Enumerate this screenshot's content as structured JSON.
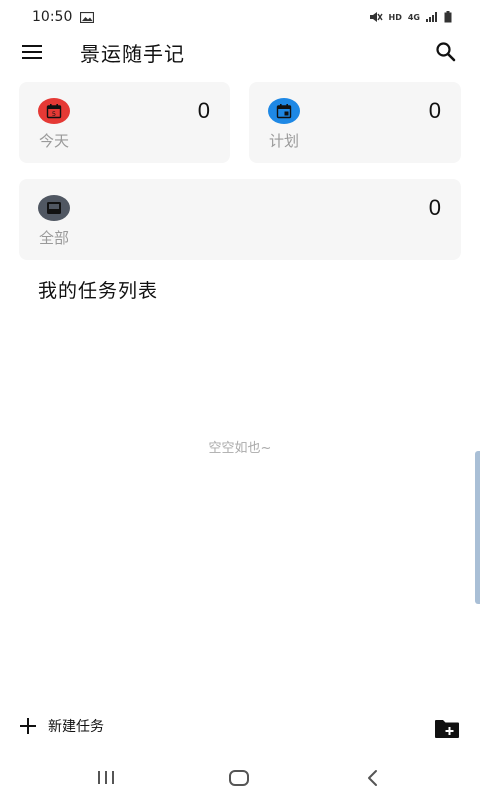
{
  "status_bar": {
    "time": "10:50",
    "network_label": "HD",
    "signal_label": "4G"
  },
  "app_bar": {
    "title": "景运随手记",
    "menu_icon": "menu-icon",
    "search_icon": "search-icon"
  },
  "cards": [
    {
      "id": "today",
      "label": "今天",
      "count": "0",
      "icon": "calendar-today-icon",
      "icon_bg": "#e53935",
      "icon_day": "5"
    },
    {
      "id": "planned",
      "label": "计划",
      "count": "0",
      "icon": "calendar-event-icon",
      "icon_bg": "#1e88e5"
    },
    {
      "id": "all",
      "label": "全部",
      "count": "0",
      "icon": "inbox-icon",
      "icon_bg": "#505762"
    }
  ],
  "task_list": {
    "title": "我的任务列表",
    "empty_hint": "空空如也~"
  },
  "bottom_bar": {
    "new_task_label": "新建任务",
    "new_folder_icon": "create-new-folder-icon"
  },
  "nav_bar": {
    "recents_icon": "recents-icon",
    "home_icon": "home-icon",
    "back_icon": "back-icon"
  }
}
